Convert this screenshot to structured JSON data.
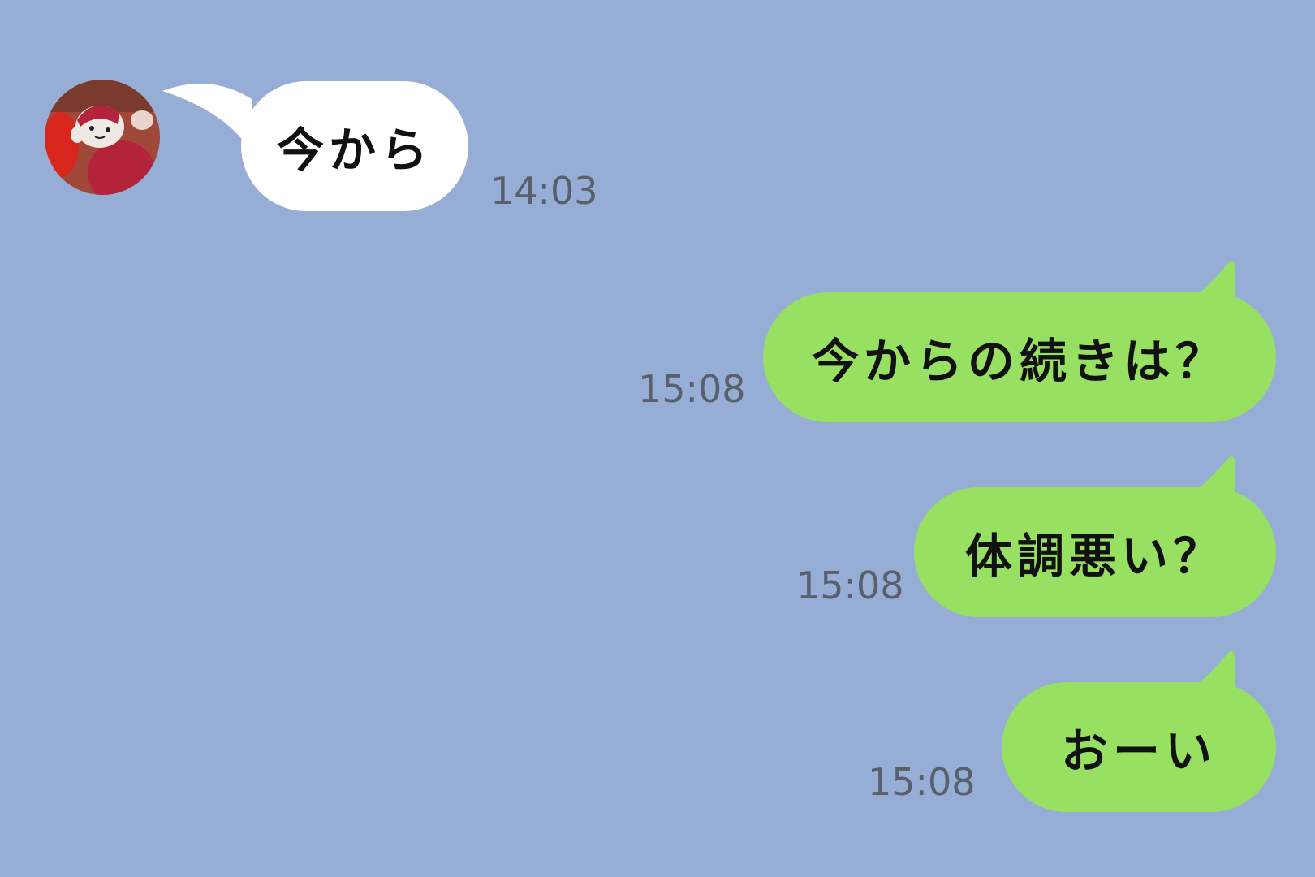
{
  "colors": {
    "background": "#96aed6",
    "incoming_bubble": "#ffffff",
    "outgoing_bubble": "#97e062",
    "timestamp_text": "#5a5f6c"
  },
  "messages": [
    {
      "direction": "incoming",
      "text": "今から",
      "time": "14:03",
      "avatar": "crochet-doll-avatar"
    },
    {
      "direction": "outgoing",
      "text": "今からの続きは？",
      "time": "15:08"
    },
    {
      "direction": "outgoing",
      "text": "体調悪い？",
      "time": "15:08"
    },
    {
      "direction": "outgoing",
      "text": "おーい",
      "time": "15:08"
    }
  ]
}
